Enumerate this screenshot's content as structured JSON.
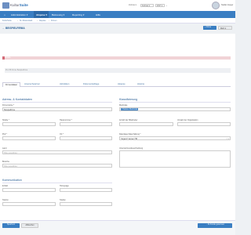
{
  "app": {
    "logo_prefix": "Kultur",
    "logo_suffix": "Suite"
  },
  "topbar": {
    "zeitraum_label": "Zeitraum",
    "month": "Februar",
    "year": "2017",
    "user": "Stefan Gayer"
  },
  "nav": {
    "items": [
      "Administration ▾",
      "Akquise ▾",
      "Betreuung ▾",
      "Reporting ▾",
      "Hilfe"
    ]
  },
  "breadcrumb": [
    "KulturSuite",
    "St. Musterstadt",
    "Akquise",
    "Firmen"
  ],
  "page": {
    "title": "BEISPIELFIRMA",
    "btn_add": "+ Firma",
    "btn_more": "Mehr ▾",
    "red_tag": "FIRMA",
    "info_text": "45-178 Firma: Beispielfirma"
  },
  "tabs": [
    "Firmendaten",
    "Ansprechpartner",
    "Aktivitäten",
    "Dokumentablage",
    "Akquise",
    "Historie"
  ],
  "sections": {
    "address": "Adress- & Kontaktdaten",
    "classification": "Klassifizierung",
    "communication": "Kommunikation"
  },
  "fields": {
    "firmenname_label": "Firmenname *",
    "firmenname_value": "Beispielfirma",
    "strasse_label": "Straße *",
    "hausnummer_label": "Hausnummer *",
    "plz_label": "PLZ *",
    "ort_label": "Ort *",
    "land_label": "Land",
    "land_placeholder": "Bitte auswählen",
    "branche_label": "Branche",
    "branche_placeholder": "Bitte auswählen",
    "merkmale_label": "Merkmale",
    "merkmale_chip": "× Weitere Merkmale",
    "anzahl_label": "Anzahl der Mitarbeiter",
    "umsatz_label": "Umsatz der Organisation",
    "datenlage_label": "Datenlage Datenhaltung *",
    "datenlage_value": "Sogar.Z: keinen HR",
    "untern_label": "Unternehmensbeschreibung",
    "email_label": "E-Mail",
    "homepage_label": "Homepage",
    "telefon_label": "Telefon",
    "telefax_label": "Telefax"
  },
  "footer": {
    "save": "Speichern",
    "cancel": "Abbrechen",
    "goto": "Zu Kunde gewonnen"
  },
  "colors": {
    "accent": "#3a7ec2",
    "title": "#2a5f95",
    "alert": "#d46c78"
  }
}
